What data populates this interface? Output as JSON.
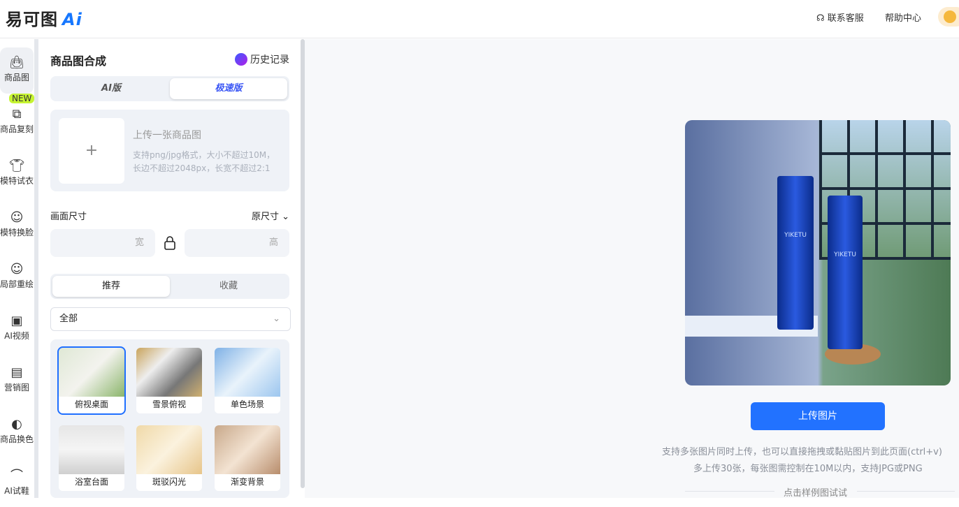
{
  "header": {
    "logo": "易可图",
    "logo_ai": "Ai",
    "contact": "联系客服",
    "help": "帮助中心"
  },
  "nav": [
    {
      "label": "商品图",
      "icon": "bag-icon"
    },
    {
      "label": "商品复刻",
      "icon": "copy-bag-icon",
      "badge": "NEW"
    },
    {
      "label": "模特试衣",
      "icon": "shirt-icon"
    },
    {
      "label": "模特换脸",
      "icon": "face-icon"
    },
    {
      "label": "局部重绘",
      "icon": "face-sparkle-icon"
    },
    {
      "label": "AI视频",
      "icon": "video-image-icon"
    },
    {
      "label": "营销图",
      "icon": "marketing-icon"
    },
    {
      "label": "商品换色",
      "icon": "color-drop-icon"
    },
    {
      "label": "AI试鞋",
      "icon": "shoe-icon"
    }
  ],
  "panel": {
    "title": "商品图合成",
    "history": "历史记录",
    "modes": [
      "AI版",
      "极速版"
    ],
    "upload": {
      "title": "上传一张商品图",
      "hint1": "支持png/jpg格式，大小不超过10M，",
      "hint2": "长边不超过2048px，长宽不超过2:1"
    },
    "size_label": "画面尺寸",
    "size_value": "原尺寸",
    "width_ph": "宽",
    "height_ph": "高",
    "tabs": [
      "推荐",
      "收藏"
    ],
    "category": "全部",
    "templates": [
      "俯视桌面",
      "雪景俯视",
      "单色场景",
      "浴室台面",
      "斑驳闪光",
      "渐变背景"
    ]
  },
  "main": {
    "bottle_brand": "YIKETU",
    "upload_btn": "上传图片",
    "hint1": "支持多张图片同时上传，也可以直接拖拽或黏贴图片到此页面(ctrl+v)",
    "hint2": "多上传30张，每张图需控制在10M以内，支持JPG或PNG",
    "sample": "点击样例图试试"
  }
}
